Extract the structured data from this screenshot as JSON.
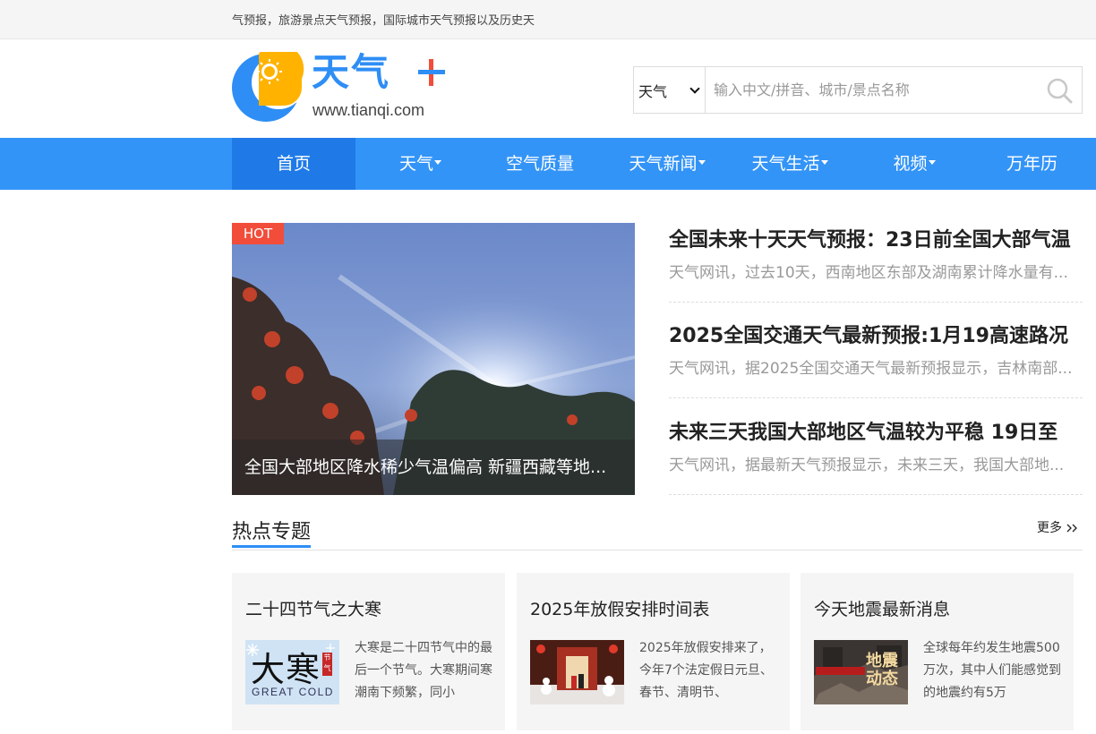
{
  "topbar": {
    "text": "气预报，旅游景点天气预报，国际城市天气预报以及历史天"
  },
  "header": {
    "logo_text": "天气",
    "logo_url": "www.tianqi.com",
    "search": {
      "selected": "天气",
      "placeholder": "输入中文/拼音、城市/景点名称"
    }
  },
  "nav": {
    "items": [
      {
        "label": "首页",
        "active": true,
        "dropdown": false
      },
      {
        "label": "天气",
        "active": false,
        "dropdown": true
      },
      {
        "label": "空气质量",
        "active": false,
        "dropdown": false
      },
      {
        "label": "天气新闻",
        "active": false,
        "dropdown": true
      },
      {
        "label": "天气生活",
        "active": false,
        "dropdown": true
      },
      {
        "label": "视频",
        "active": false,
        "dropdown": true
      },
      {
        "label": "万年历",
        "active": false,
        "dropdown": false
      }
    ]
  },
  "hero": {
    "badge": "HOT",
    "caption": "全国大部地区降水稀少气温偏高 新疆西藏等地..."
  },
  "news": [
    {
      "title": "全国未来十天天气预报：23日前全国大部气温",
      "desc": "天气网讯，过去10天，西南地区东部及湖南累计降水量有..."
    },
    {
      "title": "2025全国交通天气最新预报:1月19高速路况",
      "desc": "天气网讯，据2025全国交通天气最新预报显示，吉林南部..."
    },
    {
      "title": "未来三天我国大部地区气温较为平稳 19日至",
      "desc": "天气网讯，据最新天气预报显示，未来三天，我国大部地..."
    }
  ],
  "section": {
    "title": "热点专题",
    "more": "更多",
    "cards": [
      {
        "title": "二十四节气之大寒",
        "thumb_text": "大寒",
        "thumb_sub": "GREAT COLD",
        "thumb_seal": "节气",
        "desc": "大寒是二十四节气中的最后一个节气。大寒期间寒潮南下频繁，同小"
      },
      {
        "title": "2025年放假安排时间表",
        "thumb_text": "",
        "desc": "2025年放假安排来了，今年7个法定假日元旦、春节、清明节、"
      },
      {
        "title": "今天地震最新消息",
        "thumb_text": "地震动态",
        "desc": "全球每年约发生地震500万次，其中人们能感觉到的地震约有5万"
      }
    ]
  },
  "colors": {
    "brand": "#3394f7",
    "brand_dark": "#1f7ae8",
    "hot": "#f14d3a"
  }
}
